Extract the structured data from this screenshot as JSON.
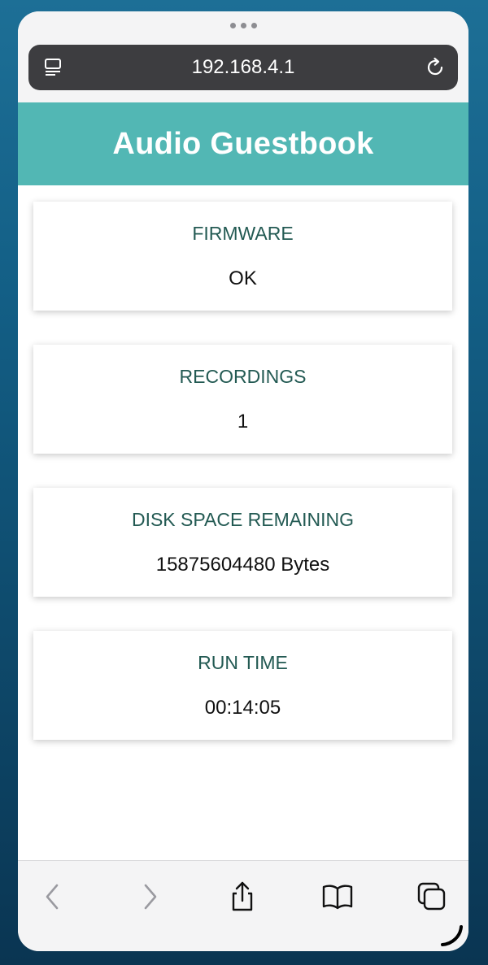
{
  "browser": {
    "url": "192.168.4.1"
  },
  "page": {
    "title": "Audio Guestbook",
    "cards": [
      {
        "label": "FIRMWARE",
        "value": "OK"
      },
      {
        "label": "RECORDINGS",
        "value": "1"
      },
      {
        "label": "DISK SPACE REMAINING",
        "value": "15875604480 Bytes"
      },
      {
        "label": "RUN TIME",
        "value": "00:14:05"
      }
    ]
  },
  "colors": {
    "header_bg": "#52b7b4",
    "label_text": "#235a53",
    "url_bar_bg": "#3d3d40"
  },
  "toolbar": {
    "icons": [
      "back-icon",
      "forward-icon",
      "share-icon",
      "bookmarks-icon",
      "tabs-icon"
    ]
  }
}
